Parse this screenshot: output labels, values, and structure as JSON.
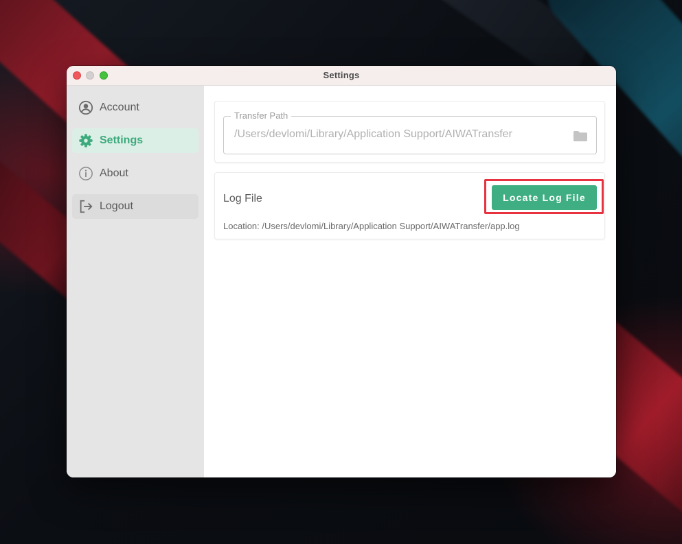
{
  "window": {
    "title": "Settings"
  },
  "sidebar": {
    "items": [
      {
        "label": "Account",
        "icon": "account-circle-icon",
        "state": "default"
      },
      {
        "label": "Settings",
        "icon": "gear-icon",
        "state": "selected"
      },
      {
        "label": "About",
        "icon": "info-icon",
        "state": "default"
      },
      {
        "label": "Logout",
        "icon": "logout-icon",
        "state": "hovered"
      }
    ]
  },
  "transfer_path": {
    "label": "Transfer Path",
    "value": "/Users/devlomi/Library/Application Support/AIWATransfer",
    "icon": "folder-icon"
  },
  "log_file": {
    "label": "Log File",
    "button_label": "Locate Log File",
    "location": "Location: /Users/devlomi/Library/Application Support/AIWATransfer/app.log"
  },
  "colors": {
    "accent": "#3fae82",
    "highlight_box": "#e8323f",
    "sidebar_bg": "#e5e5e5",
    "selected_bg": "#dcefe6"
  }
}
